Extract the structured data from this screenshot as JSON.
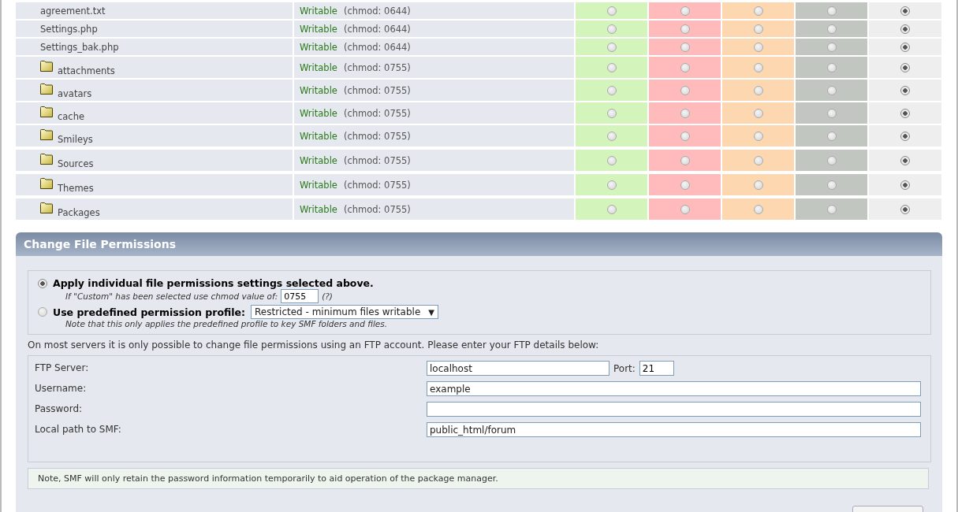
{
  "files": [
    {
      "name": "agreement.txt",
      "kind": "file",
      "status": "Writable",
      "chmod": "(chmod: 0644)",
      "options": [
        {
          "selected": false
        },
        {
          "selected": false
        },
        {
          "selected": false
        },
        {
          "selected": false
        },
        {
          "selected": true
        }
      ]
    },
    {
      "name": "Settings.php",
      "kind": "file",
      "status": "Writable",
      "chmod": "(chmod: 0644)",
      "options": [
        {
          "selected": false
        },
        {
          "selected": false
        },
        {
          "selected": false
        },
        {
          "selected": false
        },
        {
          "selected": true
        }
      ]
    },
    {
      "name": "Settings_bak.php",
      "kind": "file",
      "status": "Writable",
      "chmod": "(chmod: 0644)",
      "options": [
        {
          "selected": false
        },
        {
          "selected": false
        },
        {
          "selected": false
        },
        {
          "selected": false
        },
        {
          "selected": true
        }
      ]
    },
    {
      "name": "attachments",
      "kind": "folder",
      "status": "Writable",
      "chmod": "(chmod: 0755)",
      "options": [
        {
          "selected": false
        },
        {
          "selected": false
        },
        {
          "selected": false
        },
        {
          "selected": false
        },
        {
          "selected": true
        }
      ]
    },
    {
      "name": "avatars",
      "kind": "folder",
      "status": "Writable",
      "chmod": "(chmod: 0755)",
      "options": [
        {
          "selected": false
        },
        {
          "selected": false
        },
        {
          "selected": false
        },
        {
          "selected": false
        },
        {
          "selected": true
        }
      ]
    },
    {
      "name": "cache",
      "kind": "folder",
      "status": "Writable",
      "chmod": "(chmod: 0755)",
      "options": [
        {
          "selected": false
        },
        {
          "selected": false
        },
        {
          "selected": false
        },
        {
          "selected": false
        },
        {
          "selected": true
        }
      ]
    },
    {
      "name": "Smileys",
      "kind": "folder",
      "status": "Writable",
      "chmod": "(chmod: 0755)",
      "options": [
        {
          "selected": false
        },
        {
          "selected": false
        },
        {
          "selected": false
        },
        {
          "selected": false
        },
        {
          "selected": true
        }
      ]
    },
    {
      "name": "Sources",
      "kind": "folder",
      "status": "Writable",
      "chmod": "(chmod: 0755)",
      "options": [
        {
          "selected": false
        },
        {
          "selected": false
        },
        {
          "selected": false
        },
        {
          "selected": false
        },
        {
          "selected": true
        }
      ]
    },
    {
      "name": "Themes",
      "kind": "folder",
      "status": "Writable",
      "chmod": "(chmod: 0755)",
      "options": [
        {
          "selected": false
        },
        {
          "selected": false
        },
        {
          "selected": false
        },
        {
          "selected": false
        },
        {
          "selected": true
        }
      ]
    },
    {
      "name": "Packages",
      "kind": "folder",
      "status": "Writable",
      "chmod": "(chmod: 0755)",
      "options": [
        {
          "selected": false
        },
        {
          "selected": false
        },
        {
          "selected": false
        },
        {
          "selected": false
        },
        {
          "selected": true
        }
      ]
    }
  ],
  "change_permissions": {
    "title": "Change File Permissions",
    "modes": [
      {
        "label": "Apply individual file permissions settings selected above.",
        "selected": true,
        "hint": "If \"Custom\" has been selected use chmod value of:",
        "kind": "custom",
        "value": "0755",
        "help": "(?)"
      },
      {
        "label": "Use predefined permission profile:",
        "selected": false,
        "hint": "Note that this only applies the predefined profile to key SMF folders and files.",
        "kind": "profile",
        "value": "Restricted - minimum files writable",
        "caret": "▼"
      }
    ],
    "ftp_intro": "On most servers it is only possible to change file permissions using an FTP account. Please enter your FTP details below:",
    "ftp_fields": [
      {
        "label": "FTP Server:",
        "value": "localhost",
        "port_label": "Port:",
        "port": "21"
      },
      {
        "label": "Username:",
        "value": "example"
      },
      {
        "label": "Password:"
      },
      {
        "label": "Local path to SMF:",
        "value": "public_html/forum"
      }
    ],
    "note": "Note, SMF will only retain the password information temporarily to aid operation of the package manager."
  }
}
